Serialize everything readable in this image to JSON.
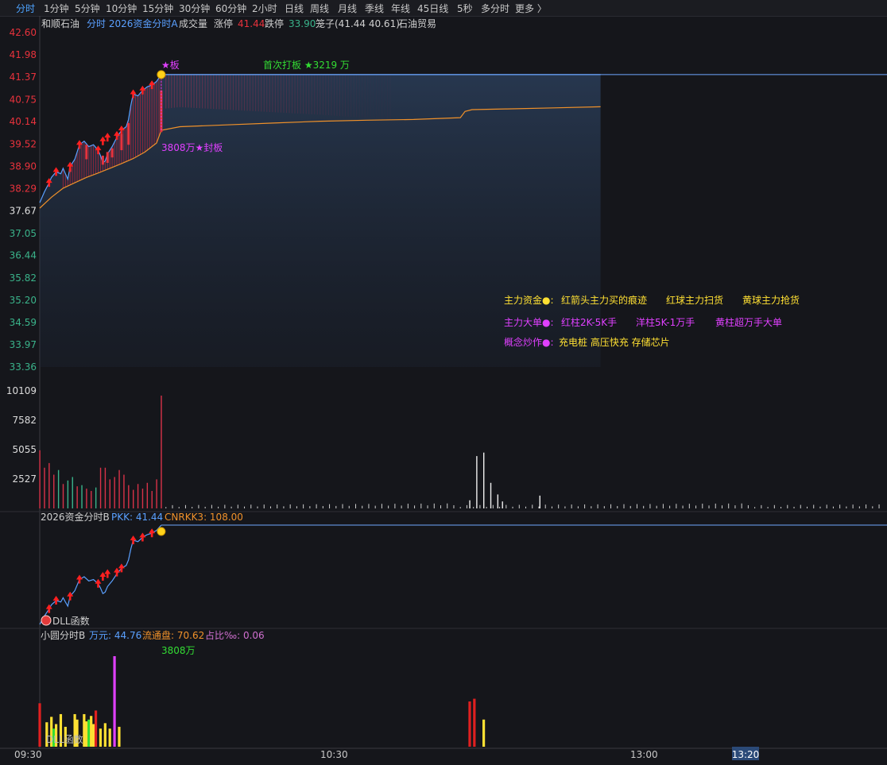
{
  "tabs": [
    "分时",
    "1分钟",
    "5分钟",
    "10分钟",
    "15分钟",
    "30分钟",
    "60分钟",
    "2小时",
    "日线",
    "周线",
    "月线",
    "季线",
    "年线",
    "45日线",
    "5秒",
    "多分时",
    "更多 〉"
  ],
  "header": {
    "stock_name": "和顺石油",
    "indicator": "分时 2026资金分时A",
    "volume_label": "成交量",
    "limit_up_label": "涨停",
    "limit_up": "41.44",
    "limit_down_label": "跌停",
    "limit_down": "33.90",
    "cage": "笼子(41.44 40.61)",
    "sector": "石油贸易"
  },
  "annotations": {
    "board": "★板",
    "first_board": "首次打板 ★3219 万",
    "seal": "3808万★封板",
    "legend_row1": [
      "主力资金●:",
      "红箭头主力买的痕迹",
      "红球主力扫货",
      "黄球主力抢货"
    ],
    "legend_row2": [
      "主力大单●:",
      "红柱2K-5K手",
      "洋柱5K-1万手",
      "黄柱超万手大单"
    ],
    "legend_row3_label": "概念炒作●:",
    "legend_row3_value": "充电桩 高压快充 存储芯片"
  },
  "panel2": {
    "name": "2026资金分时B",
    "pkk": "PKK: 41.44",
    "cnrkk": "CNRKK3: 108.00",
    "dll_label": "DLL函数"
  },
  "panel3": {
    "name": "小圆分时B",
    "wan": "万元: 44.76",
    "float": "流通盘: 70.62",
    "ratio": "占比‰: 0.06",
    "peak_label": "3808万",
    "dll_label": "DLL函数"
  },
  "time_axis": [
    "09:30",
    "10:30",
    "13:00",
    "13:20"
  ],
  "colors": {
    "price_line": "#5aa0ff",
    "avg_line": "#f0912a",
    "up": "#e8323c",
    "down": "#3ab38a",
    "magenta": "#e040ff",
    "yellow": "#ffe033",
    "green_text": "#33dd33"
  },
  "chart_data": [
    {
      "type": "line",
      "title": "和顺石油 分时",
      "y_ticks": [
        "42.60",
        "41.98",
        "41.37",
        "40.75",
        "40.14",
        "39.52",
        "38.90",
        "38.29",
        "37.67",
        "37.05",
        "36.44",
        "35.82",
        "35.20",
        "34.59",
        "33.97",
        "33.36"
      ],
      "ylim": [
        33.36,
        42.6
      ],
      "prev_close": 37.67,
      "series": [
        {
          "name": "price",
          "x": [
            0,
            2,
            4,
            5,
            7,
            9,
            10,
            11,
            12,
            13,
            15,
            17,
            19,
            21,
            23,
            25,
            26,
            27,
            28,
            29,
            31,
            33,
            35,
            37,
            38,
            39,
            40,
            42,
            44,
            46,
            48,
            50,
            52,
            240
          ],
          "values": [
            37.9,
            38.2,
            38.45,
            38.6,
            38.75,
            38.7,
            38.85,
            38.7,
            38.55,
            38.9,
            39.1,
            39.5,
            39.6,
            39.45,
            39.5,
            39.35,
            39.2,
            39.0,
            39.05,
            39.25,
            39.45,
            39.7,
            39.9,
            40.0,
            40.2,
            40.6,
            40.9,
            40.85,
            41.0,
            41.1,
            41.15,
            41.25,
            41.44,
            41.44
          ]
        },
        {
          "name": "avg",
          "x": [
            0,
            5,
            10,
            15,
            20,
            25,
            30,
            35,
            40,
            45,
            50,
            52,
            60,
            80,
            100,
            120,
            140,
            160,
            180,
            182,
            185,
            200,
            220,
            240
          ],
          "values": [
            37.75,
            38.05,
            38.3,
            38.45,
            38.6,
            38.72,
            38.85,
            38.98,
            39.12,
            39.3,
            39.55,
            39.9,
            40.0,
            40.05,
            40.1,
            40.15,
            40.18,
            40.2,
            40.25,
            40.42,
            40.47,
            40.49,
            40.52,
            40.55
          ]
        }
      ]
    },
    {
      "type": "bar",
      "title": "成交量",
      "y_ticks": [
        "10109",
        "7582",
        "5055",
        "2527"
      ],
      "ylim": [
        0,
        10109
      ],
      "x": [
        0,
        2,
        4,
        6,
        8,
        10,
        12,
        14,
        16,
        18,
        20,
        22,
        24,
        26,
        28,
        30,
        32,
        34,
        36,
        38,
        40,
        42,
        44,
        46,
        48,
        50,
        52
      ],
      "values": [
        5000,
        3500,
        3900,
        2900,
        3300,
        2100,
        2400,
        2700,
        1900,
        2000,
        1700,
        1500,
        1800,
        3500,
        3500,
        2500,
        2700,
        3300,
        2900,
        2000,
        1600,
        2100,
        1700,
        2200,
        1500,
        2500,
        9700
      ],
      "dirs": [
        1,
        1,
        1,
        1,
        -1,
        1,
        -1,
        -1,
        1,
        -1,
        1,
        1,
        -1,
        1,
        1,
        1,
        1,
        1,
        1,
        1,
        1,
        1,
        1,
        1,
        1,
        1,
        1
      ],
      "later_x": [
        184,
        187,
        190,
        193,
        196,
        198,
        214
      ],
      "later_values": [
        700,
        4500,
        4800,
        2200,
        1200,
        600,
        1100
      ]
    },
    {
      "type": "bar",
      "title": "小圆分时B",
      "x": [
        0,
        3,
        5,
        6,
        7,
        9,
        11,
        15,
        16,
        19,
        20,
        21,
        22,
        23,
        24,
        26,
        28,
        30,
        32,
        34,
        184,
        186,
        190
      ],
      "values": [
        0.48,
        0.27,
        0.33,
        0.2,
        0.25,
        0.36,
        0.22,
        0.36,
        0.3,
        0.36,
        0.28,
        0.3,
        0.34,
        0.25,
        0.4,
        0.2,
        0.26,
        0.2,
        1.0,
        0.22,
        0.5,
        0.53,
        0.3
      ],
      "kinds": [
        "r",
        "y",
        "y",
        "g",
        "y",
        "y",
        "y",
        "y",
        "y",
        "y",
        "y",
        "g",
        "y",
        "y",
        "r",
        "y",
        "y",
        "y",
        "m",
        "y",
        "r",
        "r",
        "y"
      ]
    }
  ]
}
